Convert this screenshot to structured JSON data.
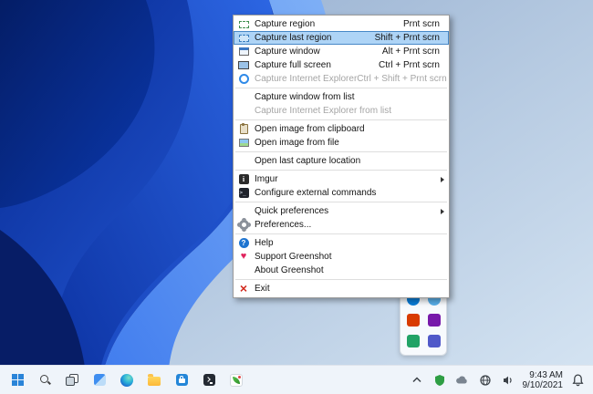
{
  "wallpaper": {
    "palette": [
      "#041d66",
      "#0b2fa6",
      "#2a62e4",
      "#7fb0f6",
      "#cadcee"
    ]
  },
  "menu": {
    "highlight_bg": "#aed4f6",
    "highlight_border": "#4788c7",
    "disabled_color": "#a5a5a5",
    "items": [
      {
        "label": "Capture region",
        "shortcut": "Prnt scrn",
        "icon": "region-capture"
      },
      {
        "label": "Capture last region",
        "shortcut": "Shift + Prnt scrn",
        "icon": "last-region-capture",
        "state": "highlighted"
      },
      {
        "label": "Capture window",
        "shortcut": "Alt + Prnt scrn",
        "icon": "window-capture"
      },
      {
        "label": "Capture full screen",
        "shortcut": "Ctrl + Prnt scrn",
        "icon": "fullscreen-capture"
      },
      {
        "label": "Capture Internet Explorer",
        "shortcut": "Ctrl + Shift + Prnt scrn",
        "icon": "internet-explorer",
        "disabled": true
      },
      {
        "label": "Capture window from list"
      },
      {
        "label": "Capture Internet Explorer from list",
        "disabled": true
      },
      {
        "label": "Open image from clipboard",
        "icon": "clipboard"
      },
      {
        "label": "Open image from file",
        "icon": "image-file"
      },
      {
        "label": "Open last capture location"
      },
      {
        "label": "Imgur",
        "icon": "imgur",
        "submenu": true
      },
      {
        "label": "Configure external commands",
        "icon": "external-commands"
      },
      {
        "label": "Quick preferences",
        "submenu": true
      },
      {
        "label": "Preferences...",
        "icon": "gear"
      },
      {
        "label": "Help",
        "icon": "help"
      },
      {
        "label": "Support Greenshot",
        "icon": "heart"
      },
      {
        "label": "About Greenshot"
      },
      {
        "label": "Exit",
        "icon": "exit"
      }
    ]
  },
  "taskbar": {
    "bg": "#eff4fa",
    "icons": [
      "start",
      "search",
      "task-view",
      "widgets",
      "edge",
      "file-explorer",
      "store",
      "terminal",
      "greenshot"
    ],
    "tray": {
      "chevron": "chevron-up",
      "icons": [
        "security-shield",
        "onedrive-cloud",
        "network",
        "volume"
      ],
      "clock": {
        "time": "9:43 AM",
        "date": "9/10/2021"
      },
      "bell": "notifications"
    }
  },
  "tray_overflow": {
    "icons": [
      {
        "name": "app-blue-round",
        "color": "#0a7cd6"
      },
      {
        "name": "app-lightblue-round",
        "color": "#58aee8"
      },
      {
        "name": "app-orange-square",
        "color": "#d83b01"
      },
      {
        "name": "app-purple-square",
        "color": "#7719aa"
      },
      {
        "name": "app-green-square",
        "color": "#21a366"
      },
      {
        "name": "app-indigo-square",
        "color": "#5059c9"
      }
    ]
  }
}
